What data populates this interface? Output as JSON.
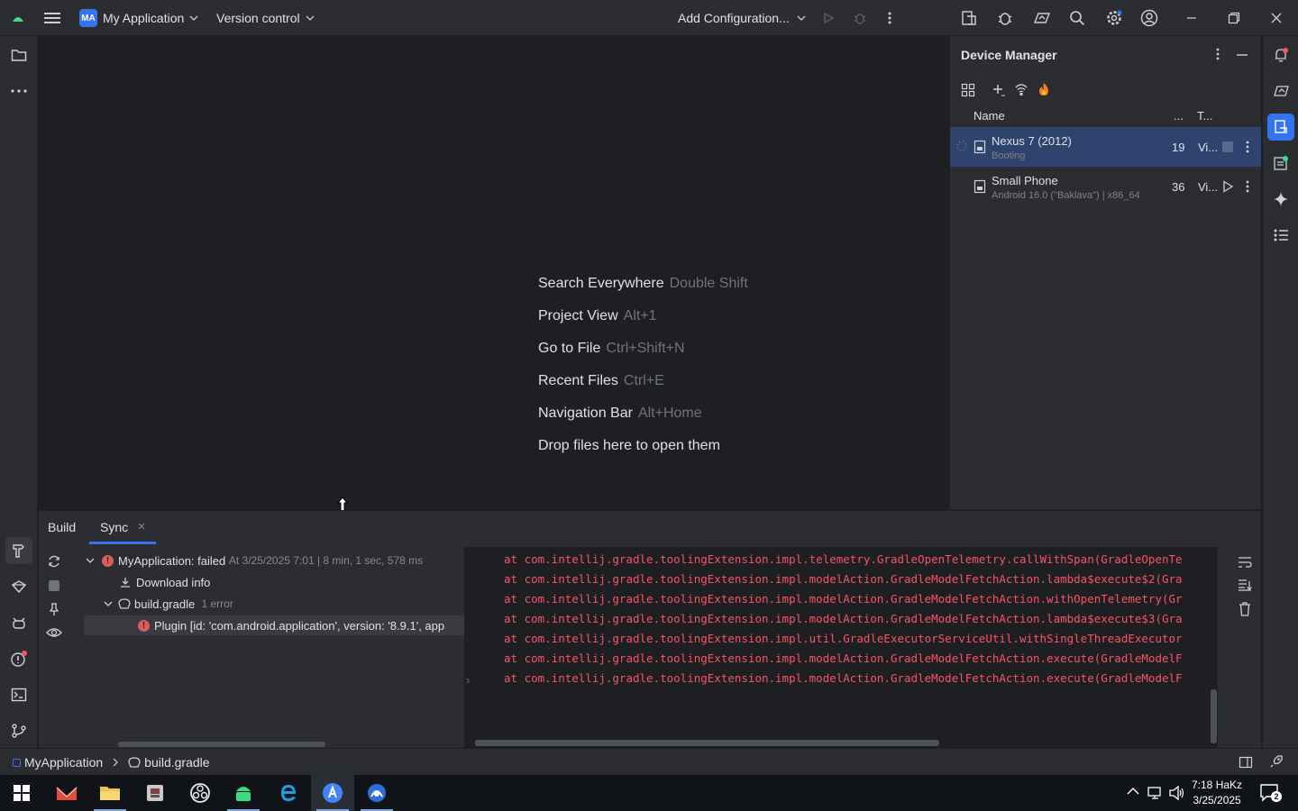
{
  "titlebar": {
    "project_initials": "MA",
    "project_name": "My Application",
    "vcs": "Version control",
    "run_config": "Add Configuration..."
  },
  "editor": {
    "hints": [
      {
        "action": "Search Everywhere",
        "shortcut": "Double Shift"
      },
      {
        "action": "Project View",
        "shortcut": "Alt+1"
      },
      {
        "action": "Go to File",
        "shortcut": "Ctrl+Shift+N"
      },
      {
        "action": "Recent Files",
        "shortcut": "Ctrl+E"
      },
      {
        "action": "Navigation Bar",
        "shortcut": "Alt+Home"
      },
      {
        "action": "Drop files here to open them",
        "shortcut": ""
      }
    ]
  },
  "device_manager": {
    "title": "Device Manager",
    "col_name": "Name",
    "col_api": "...",
    "col_type": "T...",
    "devices": [
      {
        "name": "Nexus 7 (2012)",
        "status": "Booting",
        "api": "19",
        "type": "Vi...",
        "selected": true
      },
      {
        "name": "Small Phone",
        "status": "Android 16.0 (\"Baklava\") | x86_64",
        "api": "36",
        "type": "Vi...",
        "selected": false
      }
    ]
  },
  "build": {
    "tabs": [
      "Build",
      "Sync"
    ],
    "tree": {
      "root_label": "MyApplication:",
      "root_status": "failed",
      "root_meta": "At 3/25/2025 7:01 | 8 min, 1 sec, 578 ms",
      "download": "Download info",
      "file": "build.gradle",
      "file_meta": "1 error",
      "error": "Plugin [id: 'com.android.application', version: '8.9.1', app"
    },
    "console_lines": [
      "at com.intellij.gradle.toolingExtension.impl.telemetry.GradleOpenTelemetry.callWithSpan(GradleOpenTe",
      "at com.intellij.gradle.toolingExtension.impl.modelAction.GradleModelFetchAction.lambda$execute$2(Gra",
      "at com.intellij.gradle.toolingExtension.impl.modelAction.GradleModelFetchAction.withOpenTelemetry(Gr",
      "at com.intellij.gradle.toolingExtension.impl.modelAction.GradleModelFetchAction.lambda$execute$3(Gra",
      "at com.intellij.gradle.toolingExtension.impl.util.GradleExecutorServiceUtil.withSingleThreadExecutor",
      "at com.intellij.gradle.toolingExtension.impl.modelAction.GradleModelFetchAction.execute(GradleModelF",
      "at com.intellij.gradle.toolingExtension.impl.modelAction.GradleModelFetchAction.execute(GradleModelF"
    ]
  },
  "statusbar": {
    "crumb_project": "MyApplication",
    "crumb_file": "build.gradle"
  },
  "taskbar": {
    "time": "7:18 HaKz",
    "date": "3/25/2025",
    "notifications": "2"
  },
  "colors": {
    "accent": "#3574f0",
    "error": "#f75464",
    "selection": "#2e436e"
  }
}
